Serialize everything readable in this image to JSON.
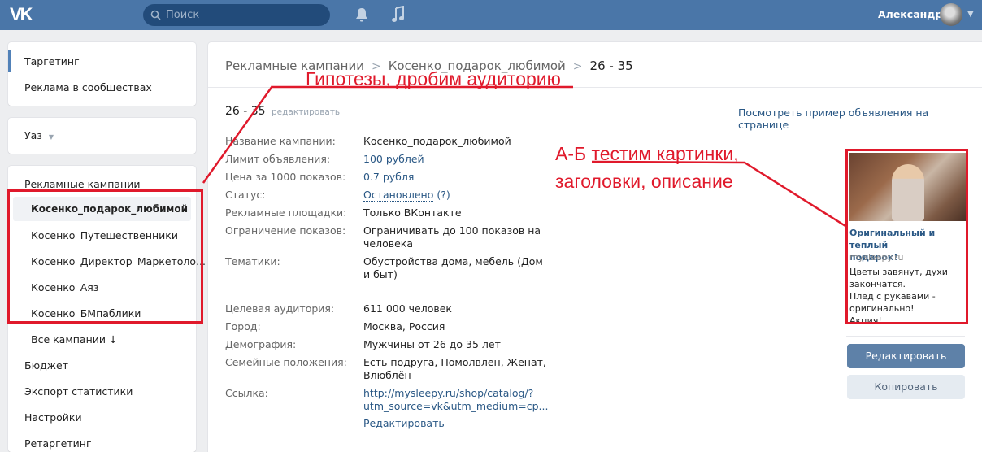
{
  "topbar": {
    "logo": "VK",
    "search_placeholder": "Поиск",
    "user_name": "Александр"
  },
  "left_menu": {
    "group1": [
      "Таргетинг",
      "Реклама в сообществах"
    ],
    "account_label": "Уаз",
    "campaigns_header": "Рекламные кампании",
    "campaigns": [
      "Косенко_подарок_любимой",
      "Косенко_Путешественники",
      "Косенко_Директор_Маркетоло...",
      "Косенко_Аяз",
      "Косенко_БМпаблики"
    ],
    "all_campaigns": "Все кампании ↓",
    "bottom_items": [
      "Бюджет",
      "Экспорт статистики",
      "Настройки",
      "Ретаргетинг"
    ]
  },
  "breadcrumbs": [
    "Рекламные кампании",
    "Косенко_подарок_любимой",
    "26 - 35"
  ],
  "ad": {
    "title": "26 - 35",
    "edit_link": "редактировать",
    "preview_link": "Посмотреть пример объявления на странице",
    "fields": [
      {
        "label": "Название кампании:",
        "value": "Косенко_подарок_любимой"
      },
      {
        "label": "Лимит объявления:",
        "value": "100 рублей"
      },
      {
        "label": "Цена за 1000 показов:",
        "value": "0.7 рубля"
      },
      {
        "label": "Статус:",
        "value": "Остановлено",
        "extra": "(?)"
      },
      {
        "label": "Рекламные площадки:",
        "value": "Только ВКонтакте"
      },
      {
        "label": "Ограничение показов:",
        "value": "Ограничивать до 100 показов на",
        "value2": "человека"
      },
      {
        "label": "Тематики:",
        "value": "Обустройства дома, мебель (Дом",
        "value2": "и быт)"
      },
      {
        "label": "Целевая аудитория:",
        "value": "611 000 человек"
      },
      {
        "label": "Город:",
        "value": "Москва, Россия"
      },
      {
        "label": "Демография:",
        "value": "Мужчины от 26 до 35 лет"
      },
      {
        "label": "Семейные положения:",
        "value": "Есть подруга, Помолвлен, Женат,",
        "value2": "Влюблён"
      },
      {
        "label": "Ссылка:",
        "value": "http://mysleepy.ru/shop/catalog/?",
        "value2": "utm_source=vk&utm_medium=cp..."
      }
    ],
    "edit_bottom": "Редактировать"
  },
  "preview": {
    "title_line1": "Оригинальный и теплый",
    "title_line2": "подарок!",
    "domain": "mysleepy.ru",
    "desc": [
      "Цветы завянут, духи",
      "закончатся.",
      "Плед с рукавами -",
      "оригинально!",
      "Акция!"
    ]
  },
  "buttons": {
    "edit": "Редактировать",
    "copy": "Копировать"
  },
  "annotations": {
    "hypotheses": "Гипотезы, дробим аудиторию",
    "ab_line1": "А-Б тестим картинки,",
    "ab_line2": "заголовки, описание"
  },
  "colors": {
    "header": "#4a76a8",
    "annotation": "#e0192b",
    "link": "#2a5885"
  }
}
